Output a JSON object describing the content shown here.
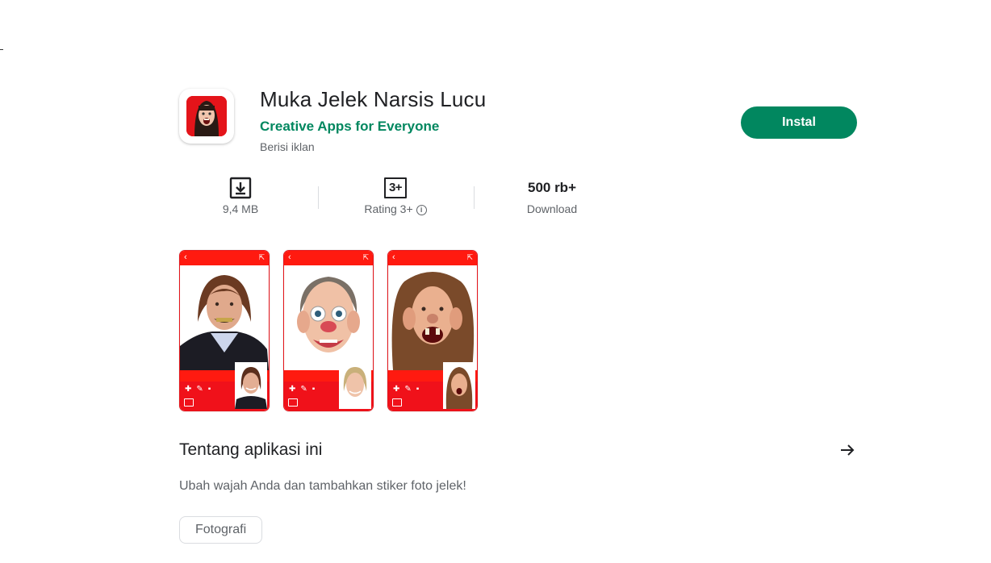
{
  "app": {
    "title": "Muka Jelek Narsis Lucu",
    "developer": "Creative Apps for Everyone",
    "ads_notice": "Berisi iklan",
    "install_label": "Instal"
  },
  "stats": {
    "size": "9,4 MB",
    "rating_badge": "3+",
    "rating_label": "Rating 3+",
    "downloads_value": "500 rb+",
    "downloads_label": "Download"
  },
  "screenshots": [
    {
      "alt": "Screenshot 1"
    },
    {
      "alt": "Screenshot 2"
    },
    {
      "alt": "Screenshot 3"
    }
  ],
  "about": {
    "title": "Tentang aplikasi ini",
    "description": "Ubah wajah Anda dan tambahkan stiker foto jelek!",
    "category": "Fotografi"
  },
  "colors": {
    "accent": "#01875f",
    "app_red": "#e4141a"
  }
}
